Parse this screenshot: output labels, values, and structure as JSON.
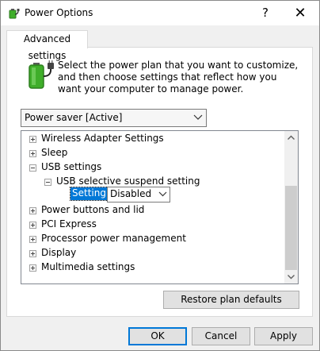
{
  "window": {
    "title": "Power Options",
    "help_symbol": "?",
    "close_symbol": "✕"
  },
  "tabs": [
    {
      "label": "Advanced settings"
    }
  ],
  "description": "Select the power plan that you want to customize, and then choose settings that reflect how you want your computer to manage power.",
  "plan_select": {
    "value": "Power saver [Active]"
  },
  "tree": {
    "items": [
      {
        "label": "Wireless Adapter Settings"
      },
      {
        "label": "Sleep"
      },
      {
        "label": "USB settings"
      },
      {
        "label": "USB selective suspend setting"
      },
      {
        "label": "Power buttons and lid"
      },
      {
        "label": "PCI Express"
      },
      {
        "label": "Processor power management"
      },
      {
        "label": "Display"
      },
      {
        "label": "Multimedia settings"
      }
    ],
    "setting_label": "Setting:",
    "setting_value": "Disabled"
  },
  "buttons": {
    "restore": "Restore plan defaults",
    "ok": "OK",
    "cancel": "Cancel",
    "apply": "Apply"
  },
  "colors": {
    "accent": "#0078d7",
    "battery_green": "#3fae2a"
  },
  "icons": {
    "title": "power-options-icon",
    "banner": "battery-plug-icon"
  }
}
